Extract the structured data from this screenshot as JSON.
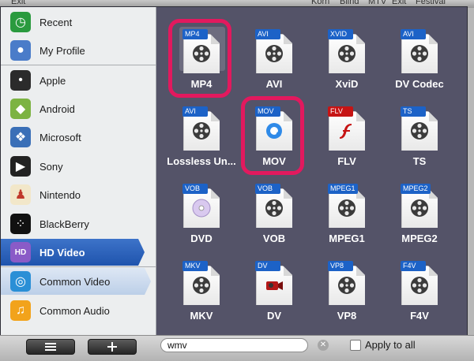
{
  "background_window": {
    "title_fragment": "Exit",
    "fragments": [
      "Korn",
      "Blind",
      "MTV",
      "Exit",
      "Festival"
    ]
  },
  "sidebar": {
    "items": [
      {
        "label": "Recent",
        "icon": "clock-icon",
        "color": "#2a9a3e"
      },
      {
        "label": "My Profile",
        "icon": "profile-icon",
        "color": "#4a7cc9"
      },
      {
        "label": "Apple",
        "icon": "apple-icon",
        "color": "#2b2b2b"
      },
      {
        "label": "Android",
        "icon": "android-icon",
        "color": "#7cb342"
      },
      {
        "label": "Microsoft",
        "icon": "windows-icon",
        "color": "#3a6fb7"
      },
      {
        "label": "Sony",
        "icon": "playstation-icon",
        "color": "#222222"
      },
      {
        "label": "Nintendo",
        "icon": "mario-icon",
        "color": "#f2e7c9"
      },
      {
        "label": "BlackBerry",
        "icon": "blackberry-icon",
        "color": "#111111"
      },
      {
        "label": "HD Video",
        "icon": "hd-video-icon",
        "color": "#8a5bc7"
      },
      {
        "label": "Common Video",
        "icon": "film-reel-icon",
        "color": "#2a8fd6"
      },
      {
        "label": "Common Audio",
        "icon": "music-note-icon",
        "color": "#f2a31b"
      }
    ],
    "active_index": 8,
    "hover_index": 9
  },
  "formats": [
    {
      "name": "MP4",
      "tag": "MP4",
      "tag_color": "#1c62c7",
      "icon": "film-reel-icon"
    },
    {
      "name": "AVI",
      "tag": "AVI",
      "tag_color": "#1c62c7",
      "icon": "film-reel-icon"
    },
    {
      "name": "XviD",
      "tag": "XVID",
      "tag_color": "#1c62c7",
      "icon": "film-reel-icon"
    },
    {
      "name": "DV Codec",
      "tag": "AVI",
      "tag_color": "#1c62c7",
      "icon": "film-reel-icon"
    },
    {
      "name": "Lossless Un...",
      "tag": "AVI",
      "tag_color": "#1c62c7",
      "icon": "film-reel-icon"
    },
    {
      "name": "MOV",
      "tag": "MOV",
      "tag_color": "#1c62c7",
      "icon": "quicktime-icon"
    },
    {
      "name": "FLV",
      "tag": "FLV",
      "tag_color": "#c61414",
      "icon": "flash-icon"
    },
    {
      "name": "TS",
      "tag": "TS",
      "tag_color": "#1c62c7",
      "icon": "film-reel-icon"
    },
    {
      "name": "DVD",
      "tag": "VOB",
      "tag_color": "#1c62c7",
      "icon": "disc-icon"
    },
    {
      "name": "VOB",
      "tag": "VOB",
      "tag_color": "#1c62c7",
      "icon": "film-reel-icon"
    },
    {
      "name": "MPEG1",
      "tag": "MPEG1",
      "tag_color": "#1c62c7",
      "icon": "film-reel-icon"
    },
    {
      "name": "MPEG2",
      "tag": "MPEG2",
      "tag_color": "#1c62c7",
      "icon": "film-reel-icon"
    },
    {
      "name": "MKV",
      "tag": "MKV",
      "tag_color": "#1c62c7",
      "icon": "film-reel-icon"
    },
    {
      "name": "DV",
      "tag": "DV",
      "tag_color": "#1c62c7",
      "icon": "camcorder-icon"
    },
    {
      "name": "VP8",
      "tag": "VP8",
      "tag_color": "#1c62c7",
      "icon": "film-reel-icon"
    },
    {
      "name": "F4V",
      "tag": "F4V",
      "tag_color": "#1c62c7",
      "icon": "film-reel-icon"
    }
  ],
  "selected_format_index": 0,
  "highlight_color": "#e2195e",
  "bottom_bar": {
    "search_value": "wmv",
    "apply_to_all_label": "Apply to all",
    "apply_to_all_checked": false
  }
}
